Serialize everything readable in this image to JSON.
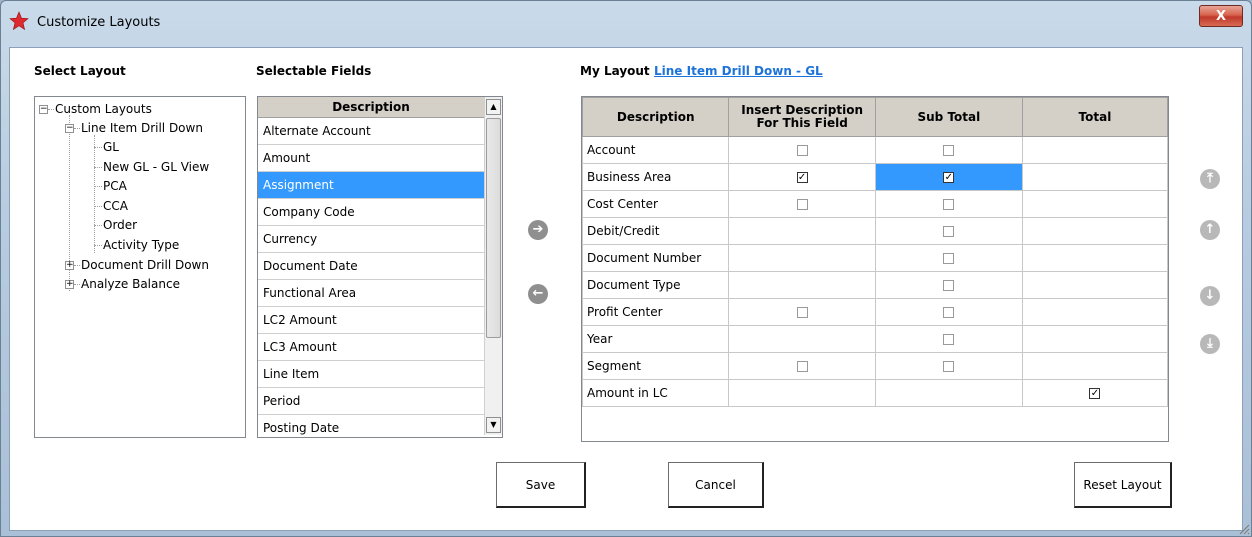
{
  "window": {
    "title": "Customize Layouts",
    "close_label": "X"
  },
  "select_layout": {
    "label": "Select Layout",
    "tree": [
      {
        "label": "Custom Layouts",
        "toggle": "−"
      },
      {
        "label": "Line Item Drill Down",
        "toggle": "−"
      },
      {
        "label": "GL"
      },
      {
        "label": "New GL - GL View"
      },
      {
        "label": "PCA"
      },
      {
        "label": "CCA"
      },
      {
        "label": "Order"
      },
      {
        "label": "Activity Type"
      },
      {
        "label": "Document Drill Down",
        "toggle": "+"
      },
      {
        "label": "Analyze Balance",
        "toggle": "+"
      }
    ]
  },
  "selectable_fields": {
    "label": "Selectable Fields",
    "header": "Description",
    "items": [
      "Alternate Account",
      "Amount",
      "Assignment",
      "Company Code",
      "Currency",
      "Document Date",
      "Functional Area",
      "LC2 Amount",
      "LC3 Amount",
      "Line Item",
      "Period",
      "Posting Date"
    ],
    "selected": "Assignment"
  },
  "my_layout": {
    "label": "My Layout",
    "link": "Line Item Drill Down - GL",
    "columns": {
      "description": "Description",
      "insert": "Insert Description For This Field",
      "subtotal": "Sub Total",
      "total": "Total"
    },
    "rows": [
      {
        "description": "Account",
        "insert": "unchecked",
        "subtotal": "unchecked",
        "total": ""
      },
      {
        "description": "Business Area",
        "insert": "checked",
        "subtotal": "checked",
        "total": ""
      },
      {
        "description": "Cost Center",
        "insert": "unchecked",
        "subtotal": "unchecked",
        "total": ""
      },
      {
        "description": "Debit/Credit",
        "insert": "",
        "subtotal": "unchecked",
        "total": ""
      },
      {
        "description": "Document Number",
        "insert": "",
        "subtotal": "unchecked",
        "total": ""
      },
      {
        "description": "Document Type",
        "insert": "",
        "subtotal": "unchecked",
        "total": ""
      },
      {
        "description": "Profit Center",
        "insert": "unchecked",
        "subtotal": "unchecked",
        "total": ""
      },
      {
        "description": "Year",
        "insert": "",
        "subtotal": "unchecked",
        "total": ""
      },
      {
        "description": "Segment",
        "insert": "unchecked",
        "subtotal": "unchecked",
        "total": ""
      },
      {
        "description": "Amount in LC",
        "insert": "",
        "subtotal": "",
        "total": "checked"
      }
    ]
  },
  "buttons": {
    "save": "Save",
    "cancel": "Cancel",
    "reset": "Reset Layout"
  },
  "icons": {
    "add": "arrow-right-circle-icon",
    "remove": "arrow-left-circle-icon",
    "top": "move-top-icon",
    "up": "move-up-icon",
    "down": "move-down-icon",
    "bottom": "move-bottom-icon"
  },
  "colors": {
    "selection": "#3399ff",
    "link": "#1e73d9",
    "close": "#c0392b"
  }
}
